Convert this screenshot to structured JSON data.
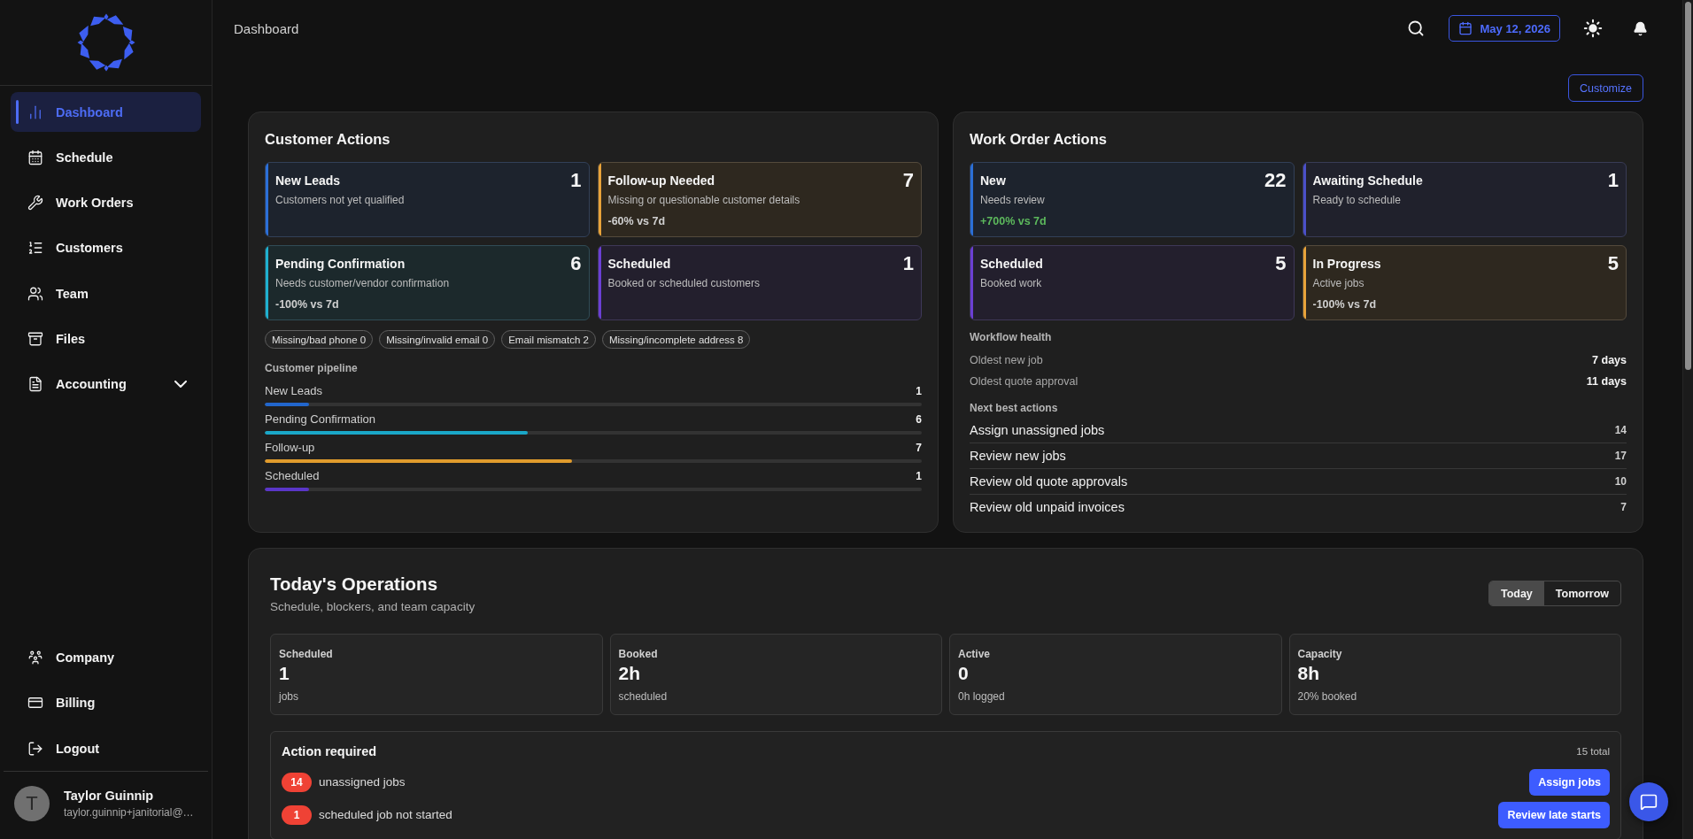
{
  "header": {
    "title": "Dashboard",
    "date": "May 12, 2026"
  },
  "sidebar": {
    "nav_items": [
      {
        "label": "Dashboard",
        "selected": true
      },
      {
        "label": "Schedule",
        "selected": false
      },
      {
        "label": "Work Orders",
        "selected": false
      },
      {
        "label": "Customers",
        "selected": false
      },
      {
        "label": "Team",
        "selected": false
      },
      {
        "label": "Files",
        "selected": false
      },
      {
        "label": "Accounting",
        "selected": false,
        "expanded": false
      }
    ],
    "bottom_items": [
      {
        "label": "Company"
      },
      {
        "label": "Billing"
      },
      {
        "label": "Logout"
      }
    ],
    "user": {
      "initial": "T",
      "name": "Taylor Guinnip",
      "email": "taylor.guinnip+janitorial@…"
    }
  },
  "customize_button": "Customize",
  "customer_actions": {
    "title": "Customer Actions",
    "cards": [
      {
        "title": "New Leads",
        "count": "1",
        "subtitle": "Customers not yet qualified",
        "color": "#2b6fd8"
      },
      {
        "title": "Follow-up Needed",
        "count": "7",
        "subtitle": "Missing or questionable customer details",
        "trend": {
          "text": "-60% vs 7d",
          "color": "#cfcfcf"
        },
        "color": "#e8a33a"
      },
      {
        "title": "Pending Confirmation",
        "count": "6",
        "subtitle": "Needs customer/vendor confirmation",
        "trend": {
          "text": "-100% vs 7d",
          "color": "#cfcfcf"
        },
        "color": "#1fb0cf"
      },
      {
        "title": "Scheduled",
        "count": "1",
        "subtitle": "Booked or scheduled customers",
        "color": "#6b3fd4"
      }
    ],
    "chips": [
      "Missing/bad phone 0",
      "Missing/invalid email 0",
      "Email mismatch 2",
      "Missing/incomplete address 8"
    ],
    "pipeline": {
      "title": "Customer pipeline",
      "rows": [
        {
          "label": "New Leads",
          "count": "1",
          "level": 0.067,
          "color": "#2266cc"
        },
        {
          "label": "Pending Confirmation",
          "count": "6",
          "level": 0.4,
          "color": "#1aa7c8"
        },
        {
          "label": "Follow-up",
          "count": "7",
          "level": 0.467,
          "color": "#e09b2c"
        },
        {
          "label": "Scheduled",
          "count": "1",
          "level": 0.067,
          "color": "#5a36c8"
        }
      ]
    }
  },
  "work_order_actions": {
    "title": "Work Order Actions",
    "cards": [
      {
        "title": "New",
        "count": "22",
        "subtitle": "Needs review",
        "trend": {
          "text": "+700% vs 7d",
          "color": "#5cb85c"
        },
        "color": "#2b6fd8"
      },
      {
        "title": "Awaiting Schedule",
        "count": "1",
        "subtitle": "Ready to schedule",
        "color": "#4b50c9"
      },
      {
        "title": "Scheduled",
        "count": "5",
        "subtitle": "Booked work",
        "color": "#6b3fd4"
      },
      {
        "title": "In Progress",
        "count": "5",
        "subtitle": "Active jobs",
        "trend": {
          "text": "-100% vs 7d",
          "color": "#cfcfcf"
        },
        "color": "#e8a33a"
      }
    ],
    "workflow_health": {
      "title": "Workflow health",
      "rows": [
        {
          "label": "Oldest new job",
          "value": "7 days"
        },
        {
          "label": "Oldest quote approval",
          "value": "11 days"
        }
      ]
    },
    "next_best_actions": {
      "title": "Next best actions",
      "items": [
        {
          "label": "Assign unassigned jobs",
          "count": "14"
        },
        {
          "label": "Review new jobs",
          "count": "17"
        },
        {
          "label": "Review old quote approvals",
          "count": "10"
        },
        {
          "label": "Review old unpaid invoices",
          "count": "7"
        }
      ]
    }
  },
  "todays_operations": {
    "title": "Today's Operations",
    "subtitle": "Schedule, blockers, and team capacity",
    "toggle": [
      {
        "label": "Today",
        "selected": true
      },
      {
        "label": "Tomorrow",
        "selected": false
      }
    ],
    "metrics": [
      {
        "label": "Scheduled",
        "value": "1",
        "caption": "jobs"
      },
      {
        "label": "Booked",
        "value": "2h",
        "caption": "scheduled"
      },
      {
        "label": "Active",
        "value": "0",
        "caption": "0h logged"
      },
      {
        "label": "Capacity",
        "value": "8h",
        "caption": "20% booked"
      }
    ],
    "action_required": {
      "title": "Action required",
      "total": "15 total",
      "items": [
        {
          "count": "14",
          "text": "unassigned jobs",
          "button": "Assign jobs"
        },
        {
          "count": "1",
          "text": "scheduled job not started",
          "button": "Review late starts"
        }
      ]
    }
  }
}
